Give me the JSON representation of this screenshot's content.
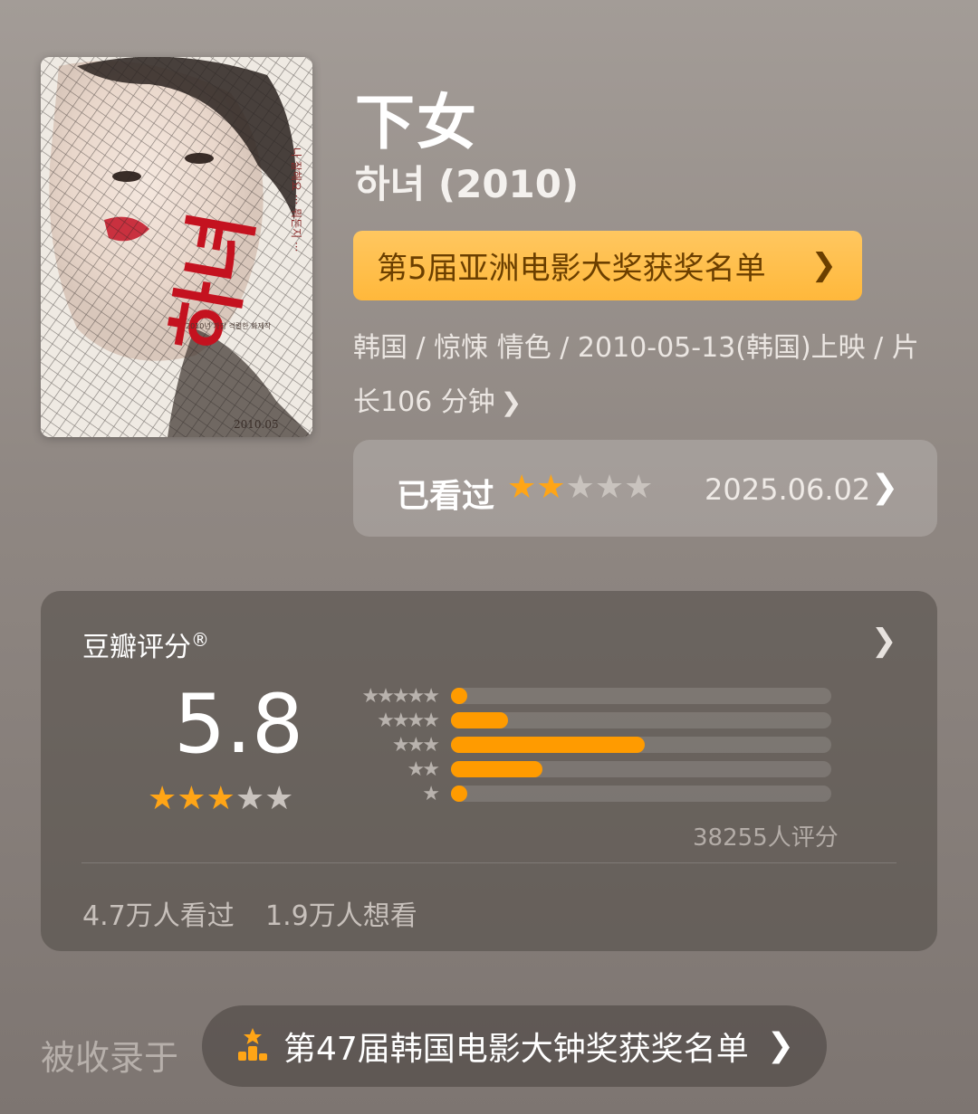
{
  "movie": {
    "title_cn": "下女",
    "title_ko": "하녀 (2010)",
    "award_button": "第5届亚洲电影大奖获奖名单",
    "meta_line1": "韩国 / 惊悚 情色 / 2010-05-13(韩国)上映 / 片",
    "meta_line2": "长106 分钟",
    "poster": {
      "vertical_text": "나 잘해요 ··· 뭐든지 ···",
      "title_glyph": "하녀",
      "tagline": "2010년 가장 격렬한 화제작",
      "date": "2010.05"
    }
  },
  "watched": {
    "label": "已看过",
    "user_rating_stars": 2,
    "max_stars": 5,
    "date": "2025.06.02"
  },
  "rating": {
    "title": "豆瓣评分",
    "registered_mark": "®",
    "score": "5.8",
    "score_stars": 3,
    "max_stars": 5,
    "count_text": "38255人评分",
    "seen_text": "4.7万人看过",
    "want_text": "1.9万人想看"
  },
  "chart_data": {
    "type": "bar",
    "categories": [
      "5星",
      "4星",
      "3星",
      "2星",
      "1星"
    ],
    "values": [
      4,
      15,
      51,
      24,
      4
    ],
    "ylim": [
      0,
      100
    ],
    "orientation": "horizontal"
  },
  "collected": {
    "label": "被收录于",
    "list_title": "第47届韩国电影大钟奖获奖名单"
  },
  "colors": {
    "accent": "#ff9b00",
    "award_bg": "#ffbd45",
    "background": "#958d88"
  },
  "icons": {
    "chevron": "chevron-right-icon",
    "star": "star-icon",
    "list": "ranking-list-icon"
  }
}
